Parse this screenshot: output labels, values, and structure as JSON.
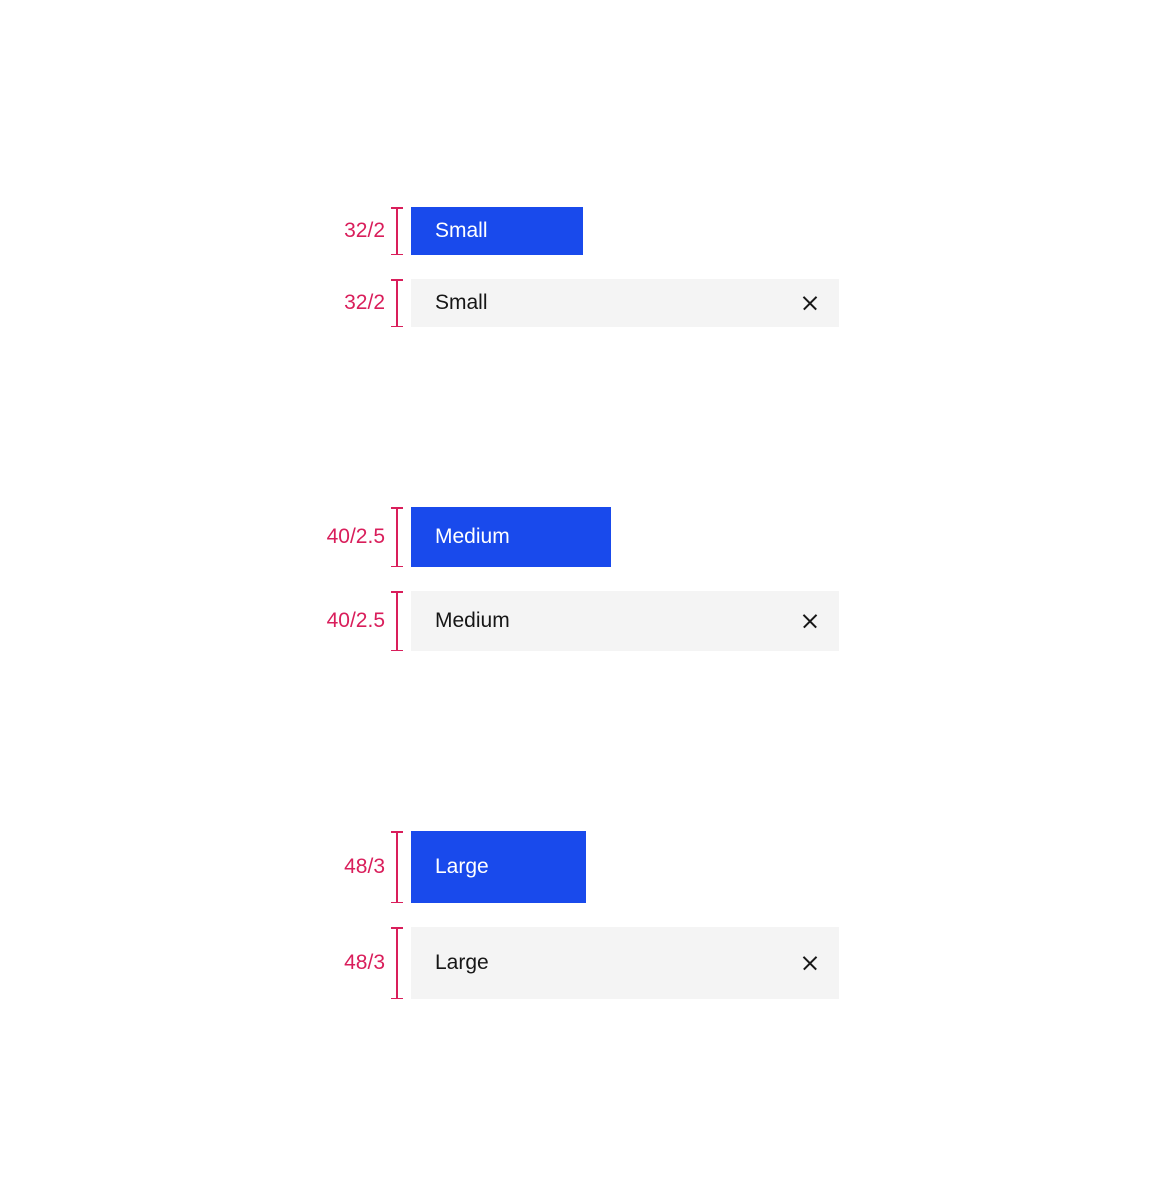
{
  "sizes": {
    "small": {
      "dimension": "32/2",
      "button_label": "Small",
      "input_value": "Small"
    },
    "medium": {
      "dimension": "40/2.5",
      "button_label": "Medium",
      "input_value": "Medium"
    },
    "large": {
      "dimension": "48/3",
      "button_label": "Large",
      "input_value": "Large"
    }
  },
  "colors": {
    "primary": "#194aec",
    "measurement": "#d91e5b",
    "input_bg": "#f4f4f4",
    "text_dark": "#161616"
  }
}
